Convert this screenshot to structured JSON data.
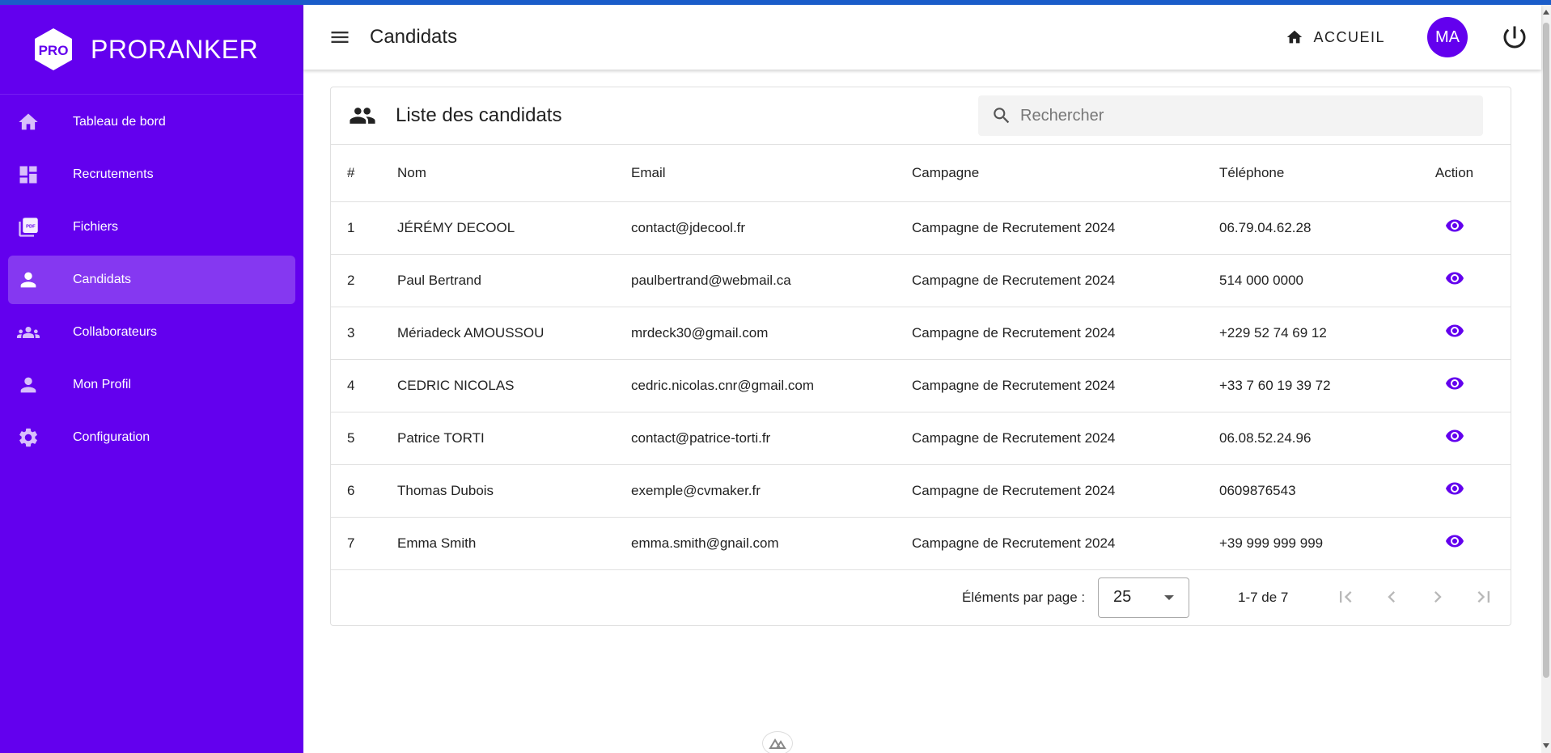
{
  "brand": {
    "logo_text": "PRO",
    "name": "PRORANKER"
  },
  "sidebar": {
    "items": [
      {
        "label": "Tableau de bord",
        "icon": "home-icon",
        "active": false
      },
      {
        "label": "Recrutements",
        "icon": "dashboard-icon",
        "active": false
      },
      {
        "label": "Fichiers",
        "icon": "pdf-icon",
        "active": false
      },
      {
        "label": "Candidats",
        "icon": "person-icon",
        "active": true
      },
      {
        "label": "Collaborateurs",
        "icon": "group-icon",
        "active": false
      },
      {
        "label": "Mon Profil",
        "icon": "person-icon",
        "active": false
      },
      {
        "label": "Configuration",
        "icon": "gear-icon",
        "active": false
      }
    ]
  },
  "header": {
    "title": "Candidats",
    "home_label": "ACCUEIL",
    "avatar_initials": "MA"
  },
  "card": {
    "title": "Liste des candidats",
    "search_placeholder": "Rechercher"
  },
  "table": {
    "columns": [
      "#",
      "Nom",
      "Email",
      "Campagne",
      "Téléphone",
      "Action"
    ],
    "rows": [
      {
        "num": "1",
        "name": "JÉRÉMY DECOOL",
        "email": "contact@jdecool.fr",
        "campaign": "Campagne de Recrutement 2024",
        "phone": "06.79.04.62.28"
      },
      {
        "num": "2",
        "name": "Paul Bertrand",
        "email": "paulbertrand@webmail.ca",
        "campaign": "Campagne de Recrutement 2024",
        "phone": "514 000 0000"
      },
      {
        "num": "3",
        "name": "Mériadeck AMOUSSOU",
        "email": "mrdeck30@gmail.com",
        "campaign": "Campagne de Recrutement 2024",
        "phone": "+229 52 74 69 12"
      },
      {
        "num": "4",
        "name": "CEDRIC NICOLAS",
        "email": "cedric.nicolas.cnr@gmail.com",
        "campaign": "Campagne de Recrutement 2024",
        "phone": "+33 7 60 19 39 72"
      },
      {
        "num": "5",
        "name": "Patrice TORTI",
        "email": "contact@patrice-torti.fr",
        "campaign": "Campagne de Recrutement 2024",
        "phone": "06.08.52.24.96"
      },
      {
        "num": "6",
        "name": "Thomas Dubois",
        "email": "exemple@cvmaker.fr",
        "campaign": "Campagne de Recrutement 2024",
        "phone": "0609876543"
      },
      {
        "num": "7",
        "name": "Emma Smith",
        "email": "emma.smith@gnail.com",
        "campaign": "Campagne de Recrutement 2024",
        "phone": "+39 999 999 999"
      }
    ]
  },
  "pagination": {
    "per_page_label": "Éléments par page :",
    "per_page_value": "25",
    "range_label": "1-7 de 7"
  },
  "colors": {
    "primary": "#6300ee",
    "sidebar_active": "#7a3cf2",
    "top_strip": "#1a5cc9"
  }
}
